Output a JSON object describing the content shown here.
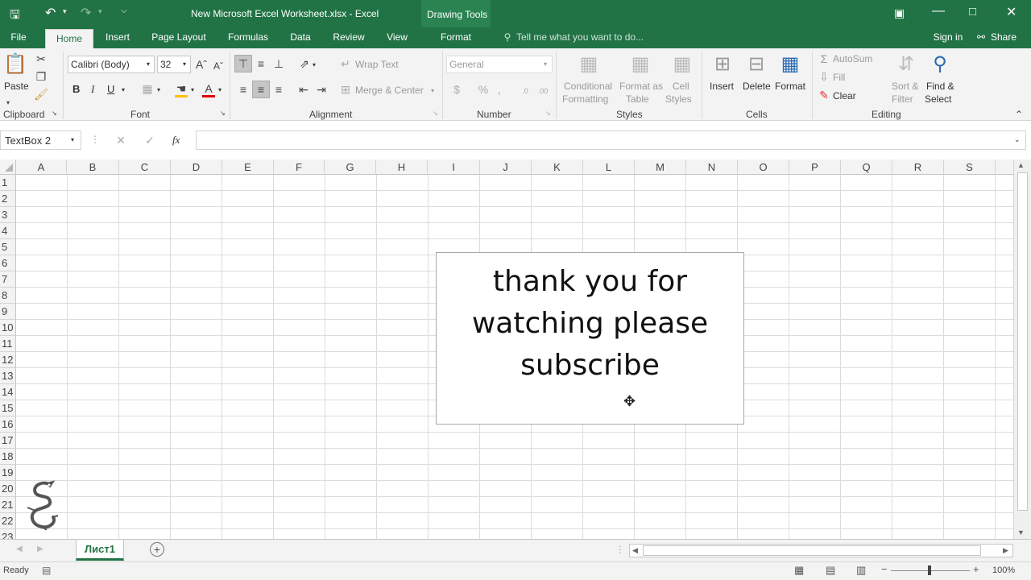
{
  "window": {
    "title": "New Microsoft Excel Worksheet.xlsx - Excel",
    "context_tab": "Drawing Tools"
  },
  "tabs": [
    "File",
    "Home",
    "Insert",
    "Page Layout",
    "Formulas",
    "Data",
    "Review",
    "View",
    "Format"
  ],
  "active_tab": "Home",
  "tell_me": "Tell me what you want to do...",
  "sign_in": "Sign in",
  "share": "Share",
  "ribbon": {
    "clipboard": {
      "paste": "Paste",
      "label": "Clipboard"
    },
    "font": {
      "name": "Calibri (Body)",
      "size": "32",
      "bold": "B",
      "italic": "I",
      "underline": "U",
      "label": "Font"
    },
    "alignment": {
      "wrap": "Wrap Text",
      "merge": "Merge & Center",
      "label": "Alignment"
    },
    "number": {
      "format": "General",
      "label": "Number"
    },
    "styles": {
      "conditional": "Conditional",
      "conditional2": "Formatting",
      "format_as": "Format as",
      "format_as2": "Table",
      "cell": "Cell",
      "cell2": "Styles",
      "label": "Styles"
    },
    "cells": {
      "insert": "Insert",
      "delete": "Delete",
      "format": "Format",
      "label": "Cells"
    },
    "editing": {
      "autosum": "AutoSum",
      "fill": "Fill",
      "clear": "Clear",
      "sort": "Sort &",
      "sort2": "Filter",
      "find": "Find &",
      "find2": "Select",
      "label": "Editing"
    }
  },
  "namebox": "TextBox 2",
  "fx": "fx",
  "columns": [
    "A",
    "B",
    "C",
    "D",
    "E",
    "F",
    "G",
    "H",
    "I",
    "J",
    "K",
    "L",
    "M",
    "N",
    "O",
    "P",
    "Q",
    "R",
    "S"
  ],
  "rows": [
    "1",
    "2",
    "3",
    "4",
    "5",
    "6",
    "7",
    "8",
    "9",
    "10",
    "11",
    "12",
    "13",
    "14",
    "15",
    "16",
    "17",
    "18",
    "19",
    "20",
    "21",
    "22",
    "23"
  ],
  "textbox_text": "thank you for watching please subscribe",
  "sheet_tab": "Лист1",
  "status": {
    "ready": "Ready",
    "zoom": "100%"
  },
  "colors": {
    "accent": "#217346",
    "grid": "#dcdcdc"
  }
}
